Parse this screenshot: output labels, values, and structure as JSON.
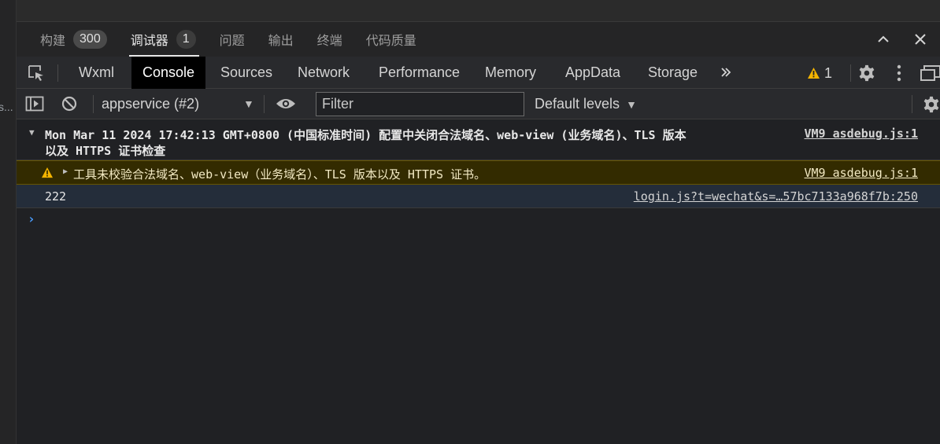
{
  "left": {
    "truncated_text": "s..."
  },
  "panel_tabs": [
    {
      "label": "构建",
      "badge": "300"
    },
    {
      "label": "调试器",
      "badge": "1"
    },
    {
      "label": "问题"
    },
    {
      "label": "输出"
    },
    {
      "label": "终端"
    },
    {
      "label": "代码质量"
    }
  ],
  "devtools_tabs": [
    "Wxml",
    "Console",
    "Sources",
    "Network",
    "Performance",
    "Memory",
    "AppData",
    "Storage"
  ],
  "warning_count": "1",
  "toolbar": {
    "context": "appservice (#2)",
    "filter_placeholder": "Filter",
    "levels": "Default levels"
  },
  "console": {
    "group_line1": "Mon Mar 11 2024 17:42:13 GMT+0800 (中国标准时间) 配置中关闭合法域名、web-view (业务域名)、TLS 版本",
    "group_line2": "以及 HTTPS 证书检查",
    "group_source": "VM9 asdebug.js:1",
    "warning_text": "工具未校验合法域名、web-view（业务域名）、TLS 版本以及 HTTPS 证书。",
    "warning_source": "VM9 asdebug.js:1",
    "log_text": "222",
    "log_source": "login.js?t=wechat&s=…57bc7133a968f7b:250"
  },
  "colors": {
    "background": "#202124",
    "warning_bg": "#332b00",
    "warning_icon": "#f4b400",
    "accent_prompt": "#4a9eff"
  }
}
